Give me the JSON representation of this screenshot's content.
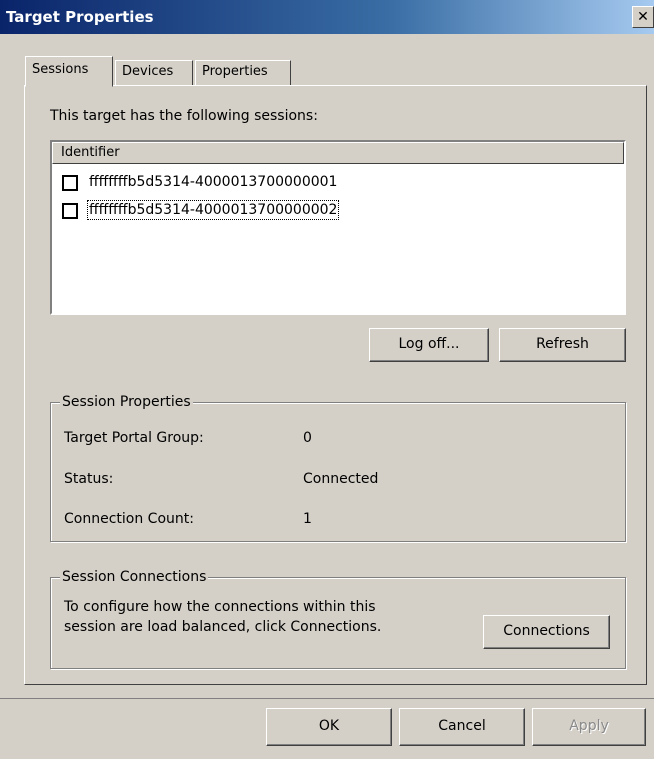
{
  "window": {
    "title": "Target Properties",
    "close_glyph": "✕"
  },
  "tabs": [
    {
      "label": "Sessions",
      "active": true
    },
    {
      "label": "Devices",
      "active": false
    },
    {
      "label": "Properties",
      "active": false
    }
  ],
  "sessions": {
    "intro_text": "This target has the following sessions:",
    "column_header": "Identifier",
    "items": [
      {
        "id": "ffffffffb5d5314-4000013700000001",
        "checked": false
      },
      {
        "id": "ffffffffb5d5314-4000013700000002",
        "checked": false,
        "focused": true
      }
    ],
    "logoff_label": "Log off...",
    "refresh_label": "Refresh"
  },
  "session_properties": {
    "legend": "Session Properties",
    "rows": [
      {
        "label": "Target Portal Group:",
        "value": "0"
      },
      {
        "label": "Status:",
        "value": "Connected"
      },
      {
        "label": "Connection Count:",
        "value": "1"
      }
    ]
  },
  "session_connections": {
    "legend": "Session Connections",
    "description": "To configure how the connections within this session are load balanced, click Connections.",
    "connections_label": "Connections"
  },
  "footer": {
    "ok_label": "OK",
    "cancel_label": "Cancel",
    "apply_label": "Apply"
  },
  "colors": {
    "face": "#d4d0c8",
    "title_bar": "#0a246a"
  }
}
